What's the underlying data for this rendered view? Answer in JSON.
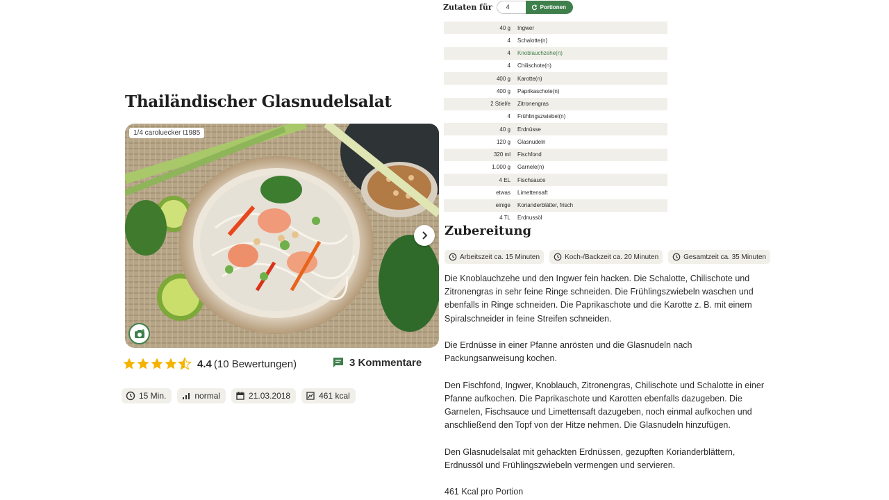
{
  "recipe": {
    "title": "Thailändischer Glasnudelsalat",
    "photo_credit": "1/4 caroluecker t1985",
    "rating": "4.4",
    "rating_count": "(10 Bewertungen)",
    "comments": "3 Kommentare",
    "stars_filled": 4.5,
    "meta": {
      "time": "15 Min.",
      "difficulty": "normal",
      "date": "21.03.2018",
      "kcal": "461 kcal"
    }
  },
  "ingredients": {
    "label": "Zutaten für",
    "portions_value": "4",
    "portions_button": "Portionen",
    "items": [
      {
        "amount": "40 g",
        "name": "Ingwer"
      },
      {
        "amount": "4",
        "name": "Schalotte(n)"
      },
      {
        "amount": "4",
        "name": "Knoblauchzehe(n)"
      },
      {
        "amount": "4",
        "name": "Chilischote(n)"
      },
      {
        "amount": "400 g",
        "name": "Karotte(n)"
      },
      {
        "amount": "400 g",
        "name": "Paprikaschote(n)"
      },
      {
        "amount": "2 Stiel/e",
        "name": "Zitronengras"
      },
      {
        "amount": "4",
        "name": "Frühlingszwiebel(n)"
      },
      {
        "amount": "40 g",
        "name": "Erdnüsse"
      },
      {
        "amount": "120 g",
        "name": "Glasnudeln"
      },
      {
        "amount": "320 ml",
        "name": "Fischfond"
      },
      {
        "amount": "1.000 g",
        "name": "Garnele(n)"
      },
      {
        "amount": "4 EL",
        "name": "Fischsauce"
      },
      {
        "amount": "etwas",
        "name": "Limettensaft"
      },
      {
        "amount": "einige",
        "name": "Korianderblätter, frisch"
      },
      {
        "amount": "4 TL",
        "name": "Erdnussöl"
      }
    ]
  },
  "preparation": {
    "title": "Zubereitung",
    "times": {
      "work": "Arbeitszeit ca. 15 Minuten",
      "cook": "Koch-/Backzeit ca. 20 Minuten",
      "total": "Gesamtzeit ca. 35 Minuten"
    },
    "steps": [
      "Die Knoblauchzehe und den Ingwer fein hacken. Die Schalotte, Chilischote und Zitronengras in sehr feine Ringe schneiden. Die Frühlingszwiebeln waschen und ebenfalls in Ringe schneiden. Die Paprikaschote und die Karotte z. B. mit einem Spiralschneider in feine Streifen schneiden.",
      "Die Erdnüsse in einer Pfanne anrösten und die Glasnudeln nach Packungsanweisung kochen.",
      "Den Fischfond, Ingwer, Knoblauch, Zitronengras, Chilischote und Schalotte in einer Pfanne aufkochen. Die Paprikaschote und Karotten ebenfalls dazugeben. Die Garnelen, Fischsauce und Limettensaft dazugeben, noch einmal aufkochen und anschließend den Topf von der Hitze nehmen. Die Glasnudeln hinzufügen.",
      "Den Glasnudelsalat mit gehackten Erdnüssen, gezupften Korianderblättern, Erdnussöl und Frühlingszwiebeln vermengen und servieren.",
      "461 Kcal pro Portion"
    ]
  },
  "colors": {
    "accent": "#3f7f4c",
    "chip_bg": "#f1efe9",
    "star": "#f5b301"
  },
  "icons": {
    "photo_next": "chevron-right-icon",
    "photo_upload": "camera-plus-icon",
    "comments": "comment-icon",
    "time": "clock-icon",
    "difficulty": "bar-chart-icon",
    "date": "calendar-icon",
    "kcal": "nutrition-icon",
    "portions": "refresh-icon"
  }
}
